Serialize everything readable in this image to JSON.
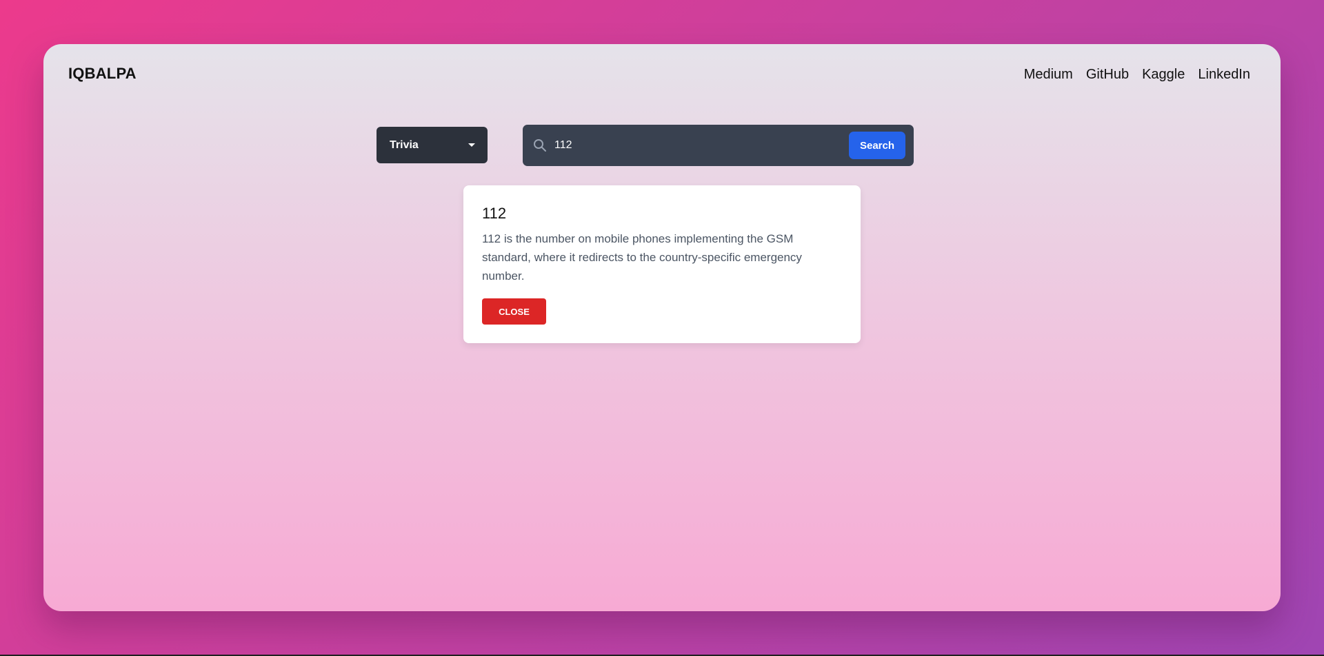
{
  "brand": "IQBALPA",
  "nav": [
    "Medium",
    "GitHub",
    "Kaggle",
    "LinkedIn"
  ],
  "category_select": {
    "selected": "Trivia",
    "icon": "chevron-down-icon"
  },
  "search": {
    "value": "112",
    "icon": "search-icon",
    "button_label": "Search"
  },
  "result": {
    "title": "112",
    "text": "112 is the number on mobile phones implementing the GSM standard, where it redirects to the country-specific emergency number.",
    "close_label": "CLOSE"
  },
  "colors": {
    "select_bg": "#2c313b",
    "search_bg": "#394150",
    "search_button": "#2563eb",
    "close_button": "#dc2626"
  }
}
